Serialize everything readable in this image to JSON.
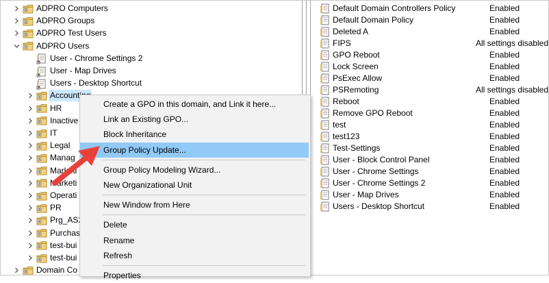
{
  "tree": {
    "items": [
      {
        "label": "ADPRO Computers",
        "icon": "ou-folder-icon",
        "expander": "chevron-right"
      },
      {
        "label": "ADPRO Groups",
        "icon": "ou-folder-icon",
        "expander": "chevron-right"
      },
      {
        "label": "ADPRO Test Users",
        "icon": "ou-folder-icon",
        "expander": "chevron-right"
      },
      {
        "label": "ADPRO Users",
        "icon": "ou-folder-icon",
        "expander": "chevron-down"
      },
      {
        "label": "User - Chrome Settings 2",
        "icon": "gpo-link-icon",
        "expander": ""
      },
      {
        "label": "User - Map Drives",
        "icon": "gpo-link-icon",
        "expander": ""
      },
      {
        "label": "Users - Desktop Shortcut",
        "icon": "gpo-link-icon",
        "expander": ""
      },
      {
        "label": "Accounting",
        "icon": "ou-folder-icon",
        "expander": "chevron-right",
        "selected": true
      },
      {
        "label": "HR",
        "icon": "ou-folder-icon",
        "expander": "chevron-right"
      },
      {
        "label": "Inactive",
        "icon": "ou-folder-icon",
        "expander": "chevron-right"
      },
      {
        "label": "IT",
        "icon": "ou-folder-icon",
        "expander": "chevron-right"
      },
      {
        "label": "Legal",
        "icon": "ou-folder-icon",
        "expander": "chevron-right"
      },
      {
        "label": "Manag",
        "icon": "ou-folder-icon",
        "expander": "chevron-right"
      },
      {
        "label": "Marketi",
        "icon": "ou-folder-icon",
        "expander": "chevron-right"
      },
      {
        "label": "Marketi",
        "icon": "ou-folder-icon",
        "expander": "chevron-right"
      },
      {
        "label": "Operati",
        "icon": "ou-folder-icon",
        "expander": "chevron-right"
      },
      {
        "label": "PR",
        "icon": "ou-folder-icon",
        "expander": "chevron-right"
      },
      {
        "label": "Prg_AS2",
        "icon": "ou-folder-icon",
        "expander": "chevron-right"
      },
      {
        "label": "Purchas",
        "icon": "ou-folder-icon",
        "expander": "chevron-right"
      },
      {
        "label": "test-bui",
        "icon": "ou-folder-icon",
        "expander": "chevron-right"
      },
      {
        "label": "test-bui",
        "icon": "ou-folder-icon",
        "expander": "chevron-right"
      },
      {
        "label": "Domain Co",
        "icon": "ou-folder-icon",
        "expander": "chevron-right"
      }
    ]
  },
  "gpo_list": {
    "rows": [
      {
        "name": "Default Domain Controllers Policy",
        "status": "Enabled"
      },
      {
        "name": "Default Domain Policy",
        "status": "Enabled"
      },
      {
        "name": "Deleted A",
        "status": "Enabled"
      },
      {
        "name": "FIPS",
        "status": "All settings disabled"
      },
      {
        "name": "GPO Reboot",
        "status": "Enabled"
      },
      {
        "name": "Lock Screen",
        "status": "Enabled"
      },
      {
        "name": "PsExec Allow",
        "status": "Enabled"
      },
      {
        "name": "PSRemoting",
        "status": "All settings disabled"
      },
      {
        "name": "Reboot",
        "status": "Enabled"
      },
      {
        "name": "Remove GPO Reboot",
        "status": "Enabled"
      },
      {
        "name": "test",
        "status": "Enabled"
      },
      {
        "name": "test123",
        "status": "Enabled"
      },
      {
        "name": "Test-Settings",
        "status": "Enabled"
      },
      {
        "name": "User - Block Control Panel",
        "status": "Enabled"
      },
      {
        "name": "User - Chrome Settings",
        "status": "Enabled"
      },
      {
        "name": "User - Chrome Settings 2",
        "status": "Enabled"
      },
      {
        "name": "User - Map Drives",
        "status": "Enabled"
      },
      {
        "name": "Users - Desktop Shortcut",
        "status": "Enabled"
      }
    ]
  },
  "context_menu": {
    "items": [
      {
        "label": "Create a GPO in this domain, and Link it here..."
      },
      {
        "label": "Link an Existing GPO..."
      },
      {
        "label": "Block Inheritance"
      },
      {
        "label": "Group Policy Update...",
        "highlighted": true
      },
      {
        "separator": true
      },
      {
        "label": "Group Policy Modeling Wizard..."
      },
      {
        "label": "New Organizational Unit"
      },
      {
        "separator": true
      },
      {
        "label": "New Window from Here"
      },
      {
        "separator": true
      },
      {
        "label": "Delete"
      },
      {
        "label": "Rename"
      },
      {
        "label": "Refresh"
      },
      {
        "separator": true
      },
      {
        "label": "Properties"
      }
    ]
  },
  "colors": {
    "selection": "#cce8ff",
    "menu_highlight": "#91c9f7",
    "menu_background": "#f2f2f2",
    "annotation_arrow": "#e8413c"
  }
}
